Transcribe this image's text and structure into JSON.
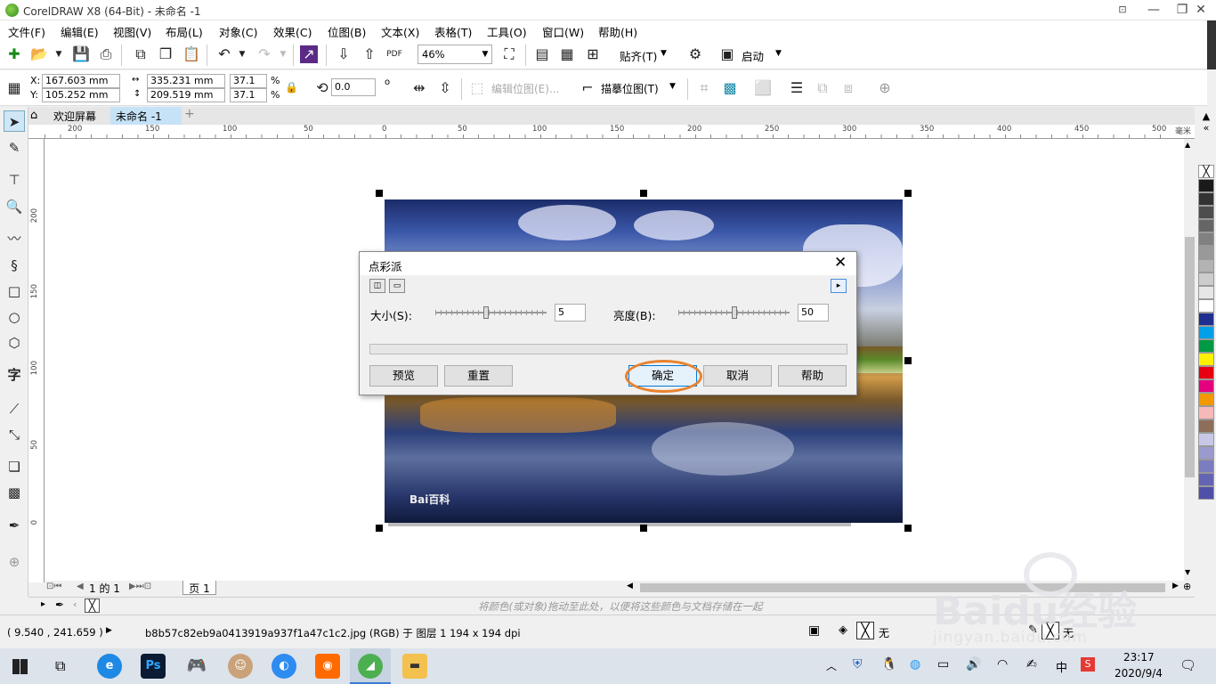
{
  "window": {
    "title": "CorelDRAW X8 (64-Bit) - 未命名 -1",
    "minimize": "—",
    "maximize": "❐",
    "close": "✕"
  },
  "menu": [
    "文件(F)",
    "编辑(E)",
    "视图(V)",
    "布局(L)",
    "对象(C)",
    "效果(C)",
    "位图(B)",
    "文本(X)",
    "表格(T)",
    "工具(O)",
    "窗口(W)",
    "帮助(H)"
  ],
  "toolbar": {
    "zoom": "46%",
    "snap_label": "贴齐(T)",
    "launch_label": "启动"
  },
  "propbar": {
    "x": "167.603 mm",
    "y": "105.252 mm",
    "width": "335.231 mm",
    "height": "209.519 mm",
    "scale_w": "37.1",
    "scale_h": "37.1",
    "pct1": "%",
    "pct2": "%",
    "rotation": "0.0",
    "degree": "o",
    "x_label": "X:",
    "y_label": "Y:",
    "edit_bitmap": "编辑位图(E)...",
    "trace_bitmap": "描摹位图(T)"
  },
  "tabs": {
    "welcome": "欢迎屏幕",
    "doc": "未命名 -1",
    "add": "+"
  },
  "ruler": {
    "h_ticks": [
      "200",
      "150",
      "100",
      "50",
      "0",
      "50",
      "100",
      "150",
      "200",
      "250",
      "300",
      "350",
      "400",
      "450",
      "500"
    ],
    "h_unit": "毫米",
    "v_ticks": [
      "200",
      "150",
      "100",
      "50",
      "0"
    ]
  },
  "dialog": {
    "title": "点彩派",
    "size_label": "大小(S):",
    "size_value": "5",
    "brightness_label": "亮度(B):",
    "brightness_value": "50",
    "size_level": 0.45,
    "brightness_level": 0.5,
    "preview": "预览",
    "reset": "重置",
    "ok": "确定",
    "cancel": "取消",
    "help": "帮助",
    "highlight_color": "#e8822e"
  },
  "image": {
    "watermark": "Bai百科"
  },
  "pages": {
    "nav": "1 的 1",
    "page_tab": "页 1"
  },
  "colorbar": {
    "hint": "将颜色(或对象)拖动至此处，以便将这些颜色与文档存储在一起"
  },
  "status": {
    "coords": "( 9.540 , 241.659 )",
    "info": "b8b57c82eb9a0413919a937f1a47c1c2.jpg (RGB) 于 图层 1 194 x 194 dpi",
    "fill": "无",
    "outline": "无"
  },
  "taskbar": {
    "time": "23:17",
    "date": "2020/9/4",
    "ime": "中"
  },
  "overlay_watermark": {
    "line1": "Baidu经验",
    "line2": "jingyan.baidu.com"
  },
  "palette": [
    "#1a1a1a",
    "#333333",
    "#4d4d4d",
    "#666666",
    "#808080",
    "#999999",
    "#b3b3b3",
    "#cccccc",
    "#e6e6e6",
    "#ffffff",
    "#1f2f8f",
    "#00a0e9",
    "#009944",
    "#fff100",
    "#e60012",
    "#e4007f",
    "#f39800",
    "#f6b8b8",
    "#8c6e5a",
    "#c8c8e6",
    "#9a9acd",
    "#7c7cc0",
    "#6464b4",
    "#5050a8"
  ]
}
